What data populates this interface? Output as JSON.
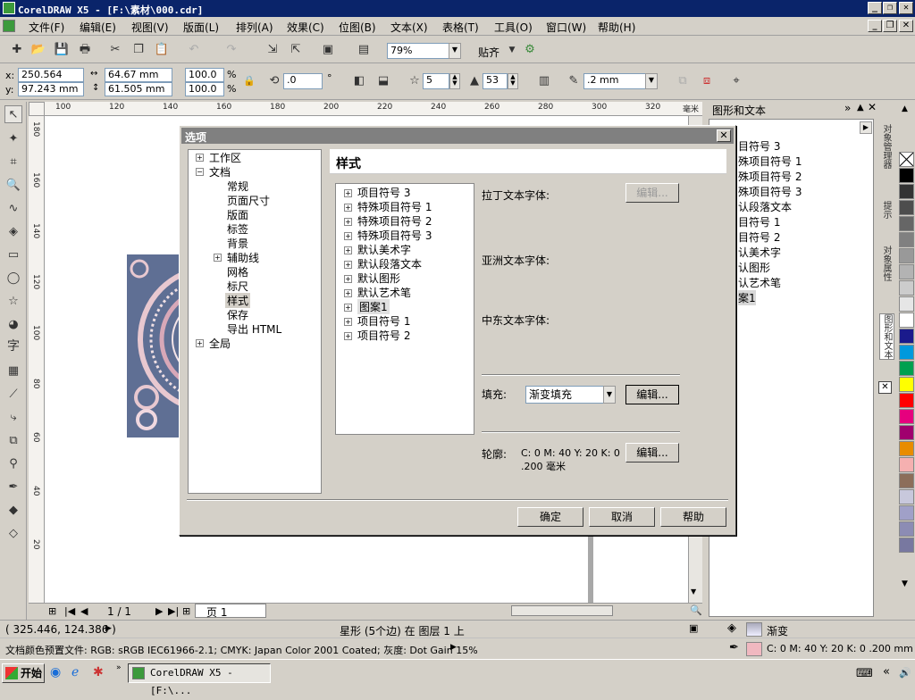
{
  "titlebar": {
    "title": "CorelDRAW X5 - [F:\\素材\\000.cdr]",
    "min": "_",
    "restore": "❐",
    "close": "✕"
  },
  "menubar": {
    "items": [
      "文件(F)",
      "编辑(E)",
      "视图(V)",
      "版面(L)",
      "排列(A)",
      "效果(C)",
      "位图(B)",
      "文本(X)",
      "表格(T)",
      "工具(O)",
      "窗口(W)",
      "帮助(H)"
    ]
  },
  "toolbar1": {
    "zoom": "79%",
    "snap_label": "贴齐"
  },
  "propbar": {
    "x_label": "x:",
    "x": "250.564 mm",
    "y_label": "y:",
    "y": "97.243 mm",
    "w": "64.67 mm",
    "h": "61.505 mm",
    "sx": "100.0",
    "sy": "100.0",
    "pct": "%",
    "rotation": ".0",
    "deg": "°",
    "points": "5",
    "sharpness": "53",
    "outline_width": ".2 mm"
  },
  "ruler": {
    "h_ticks": [
      "100",
      "120",
      "140",
      "160",
      "180",
      "200",
      "220",
      "240",
      "260",
      "280",
      "300",
      "320"
    ],
    "unit": "毫米",
    "v_ticks": [
      "180",
      "160",
      "140",
      "120",
      "100",
      "80",
      "60",
      "40",
      "20"
    ]
  },
  "pager": {
    "count": "1 / 1",
    "page_tab": "页 1"
  },
  "docker": {
    "title": "图形和文本",
    "items": [
      "目符号 3",
      "殊项目符号 1",
      "殊项目符号 2",
      "殊项目符号 3",
      "认段落文本",
      "目符号 1",
      "目符号 2",
      "认美术字",
      "认图形",
      "认艺术笔",
      "案1"
    ],
    "tabs": [
      "对象管理器",
      "提示",
      "对象属性",
      "图形和文本"
    ]
  },
  "palette": {
    "colors": [
      "#000000",
      "#333333",
      "#4d4d4d",
      "#666666",
      "#808080",
      "#999999",
      "#b3b3b3",
      "#cccccc",
      "#e6e6e6",
      "#ffffff",
      "#1a1a8c",
      "#0099dd",
      "#00a050",
      "#ffff00",
      "#ff0000",
      "#e6007e",
      "#a0006e",
      "#e88c00",
      "#f5b0b0",
      "#8c6e5a",
      "#c8c8dc",
      "#a0a0c8",
      "#8c8cb4",
      "#7878a0"
    ]
  },
  "dialog": {
    "title": "选项",
    "close": "✕",
    "tree": {
      "workspace": "工作区",
      "document": "文档",
      "children": [
        "常规",
        "页面尺寸",
        "版面",
        "标签",
        "背景",
        "辅助线",
        "网格",
        "标尺",
        "样式",
        "保存",
        "导出 HTML"
      ],
      "global": "全局"
    },
    "section_title": "样式",
    "styles": [
      "项目符号 3",
      "特殊项目符号 1",
      "特殊项目符号 2",
      "特殊项目符号 3",
      "默认美术字",
      "默认段落文本",
      "默认图形",
      "默认艺术笔",
      "图案1",
      "项目符号 1",
      "项目符号 2"
    ],
    "latin_font_label": "拉丁文本字体:",
    "asian_font_label": "亚洲文本字体:",
    "me_font_label": "中东文本字体:",
    "edit_label": "编辑...",
    "fill_label": "填充:",
    "fill_value": "渐变填充",
    "outline_label": "轮廓:",
    "outline_value_1": "C: 0 M: 40 Y: 20 K: 0",
    "outline_value_2": ".200 毫米",
    "ok": "确定",
    "cancel": "取消",
    "help": "帮助"
  },
  "status": {
    "coords": "( 325.446, 124.386 )",
    "object": "星形 (5个边) 在 图层 1 上",
    "fill_name": "渐变",
    "profile": "文档颜色预置文件: RGB: sRGB IEC61966-2.1; CMYK: Japan Color 2001 Coated; 灰度: Dot Gain 15%",
    "outline_desc": "C: 0 M: 40 Y: 20 K: 0  .200 mm"
  },
  "taskbar": {
    "start": "开始",
    "task": "CorelDRAW X5 - [F:\\..."
  }
}
